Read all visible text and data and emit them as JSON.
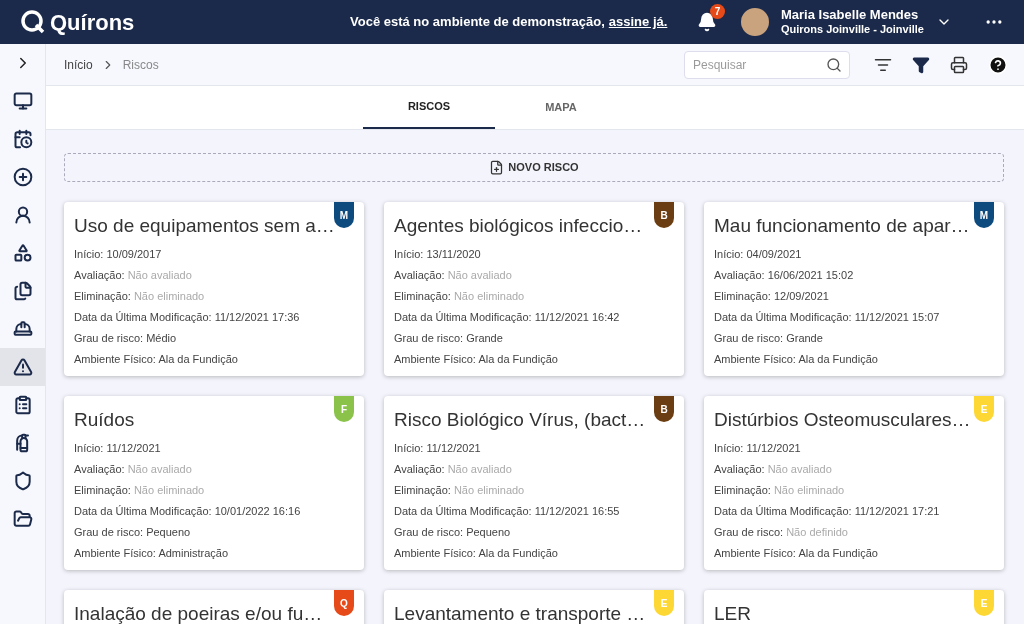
{
  "header": {
    "logo": "Quírons",
    "notice": "Você está no ambiente de demonstração,",
    "notice_link": "assine já.",
    "notifications": "7",
    "user": {
      "name": "Maria Isabelle Mendes",
      "org": "Quirons Joinville - Joinville"
    }
  },
  "sidebar": {
    "items": [
      {
        "selected": false
      },
      {
        "selected": false
      },
      {
        "selected": false
      },
      {
        "selected": false
      },
      {
        "selected": false
      },
      {
        "selected": false
      },
      {
        "selected": false
      },
      {
        "selected": true
      },
      {
        "selected": false
      },
      {
        "selected": false
      },
      {
        "selected": false
      },
      {
        "selected": false
      }
    ]
  },
  "breadcrumb": [
    "Início",
    "Riscos"
  ],
  "search": {
    "placeholder": "Pesquisar"
  },
  "tabs": [
    {
      "label": "RISCOS",
      "selected": true
    },
    {
      "label": "MAPA",
      "selected": false
    }
  ],
  "new_button": "NOVO RISCO",
  "cards": [
    {
      "title": "Uso de equipamentos sem a…",
      "badge": "M",
      "color": "#0d4a7e",
      "fields": [
        {
          "label": "Início:",
          "value": "10/09/2017",
          "muted": false
        },
        {
          "label": "Avaliação:",
          "value": "Não avaliado",
          "muted": true
        },
        {
          "label": "Eliminação:",
          "value": "Não eliminado",
          "muted": true
        },
        {
          "label": "Data da Última Modificação:",
          "value": "11/12/2021 17:36",
          "muted": false
        },
        {
          "label": "Grau de risco:",
          "value": "Médio",
          "muted": false
        },
        {
          "label": "Ambiente Físico:",
          "value": "Ala da Fundição",
          "muted": false
        }
      ]
    },
    {
      "title": "Agentes biológicos infeccio…",
      "badge": "B",
      "color": "#6b3d12",
      "fields": [
        {
          "label": "Início:",
          "value": "13/11/2020",
          "muted": false
        },
        {
          "label": "Avaliação:",
          "value": "Não avaliado",
          "muted": true
        },
        {
          "label": "Eliminação:",
          "value": "Não eliminado",
          "muted": true
        },
        {
          "label": "Data da Última Modificação:",
          "value": "11/12/2021 16:42",
          "muted": false
        },
        {
          "label": "Grau de risco:",
          "value": "Grande",
          "muted": false
        },
        {
          "label": "Ambiente Físico:",
          "value": "Ala da Fundição",
          "muted": false
        }
      ]
    },
    {
      "title": "Mau funcionamento de apar…",
      "badge": "M",
      "color": "#0d4a7e",
      "fields": [
        {
          "label": "Início:",
          "value": "04/09/2021",
          "muted": false
        },
        {
          "label": "Avaliação:",
          "value": "16/06/2021 15:02",
          "muted": false
        },
        {
          "label": "Eliminação:",
          "value": "12/09/2021",
          "muted": false
        },
        {
          "label": "Data da Última Modificação:",
          "value": "11/12/2021 15:07",
          "muted": false
        },
        {
          "label": "Grau de risco:",
          "value": "Grande",
          "muted": false
        },
        {
          "label": "Ambiente Físico:",
          "value": "Ala da Fundição",
          "muted": false
        }
      ]
    },
    {
      "title": "Ruídos",
      "badge": "F",
      "color": "#8bc34a",
      "fields": [
        {
          "label": "Início:",
          "value": "11/12/2021",
          "muted": false
        },
        {
          "label": "Avaliação:",
          "value": "Não avaliado",
          "muted": true
        },
        {
          "label": "Eliminação:",
          "value": "Não eliminado",
          "muted": true
        },
        {
          "label": "Data da Última Modificação:",
          "value": "10/01/2022 16:16",
          "muted": false
        },
        {
          "label": "Grau de risco:",
          "value": "Pequeno",
          "muted": false
        },
        {
          "label": "Ambiente Físico:",
          "value": "Administração",
          "muted": false
        }
      ]
    },
    {
      "title": "Risco Biológico Vírus, (bact…",
      "badge": "B",
      "color": "#6b3d12",
      "fields": [
        {
          "label": "Início:",
          "value": "11/12/2021",
          "muted": false
        },
        {
          "label": "Avaliação:",
          "value": "Não avaliado",
          "muted": true
        },
        {
          "label": "Eliminação:",
          "value": "Não eliminado",
          "muted": true
        },
        {
          "label": "Data da Última Modificação:",
          "value": "11/12/2021 16:55",
          "muted": false
        },
        {
          "label": "Grau de risco:",
          "value": "Pequeno",
          "muted": false
        },
        {
          "label": "Ambiente Físico:",
          "value": "Ala da Fundição",
          "muted": false
        }
      ]
    },
    {
      "title": "Distúrbios Osteomusculares…",
      "badge": "E",
      "color": "#fdd835",
      "fields": [
        {
          "label": "Início:",
          "value": "11/12/2021",
          "muted": false
        },
        {
          "label": "Avaliação:",
          "value": "Não avaliado",
          "muted": true
        },
        {
          "label": "Eliminação:",
          "value": "Não eliminado",
          "muted": true
        },
        {
          "label": "Data da Última Modificação:",
          "value": "11/12/2021 17:21",
          "muted": false
        },
        {
          "label": "Grau de risco:",
          "value": "Não definido",
          "muted": true
        },
        {
          "label": "Ambiente Físico:",
          "value": "Ala da Fundição",
          "muted": false
        }
      ]
    },
    {
      "title": "Inalação de poeiras e/ou fu…",
      "badge": "Q",
      "color": "#e64a19"
    },
    {
      "title": "Levantamento e transporte …",
      "badge": "E",
      "color": "#fdd835"
    },
    {
      "title": "LER",
      "badge": "E",
      "color": "#fdd835"
    }
  ]
}
